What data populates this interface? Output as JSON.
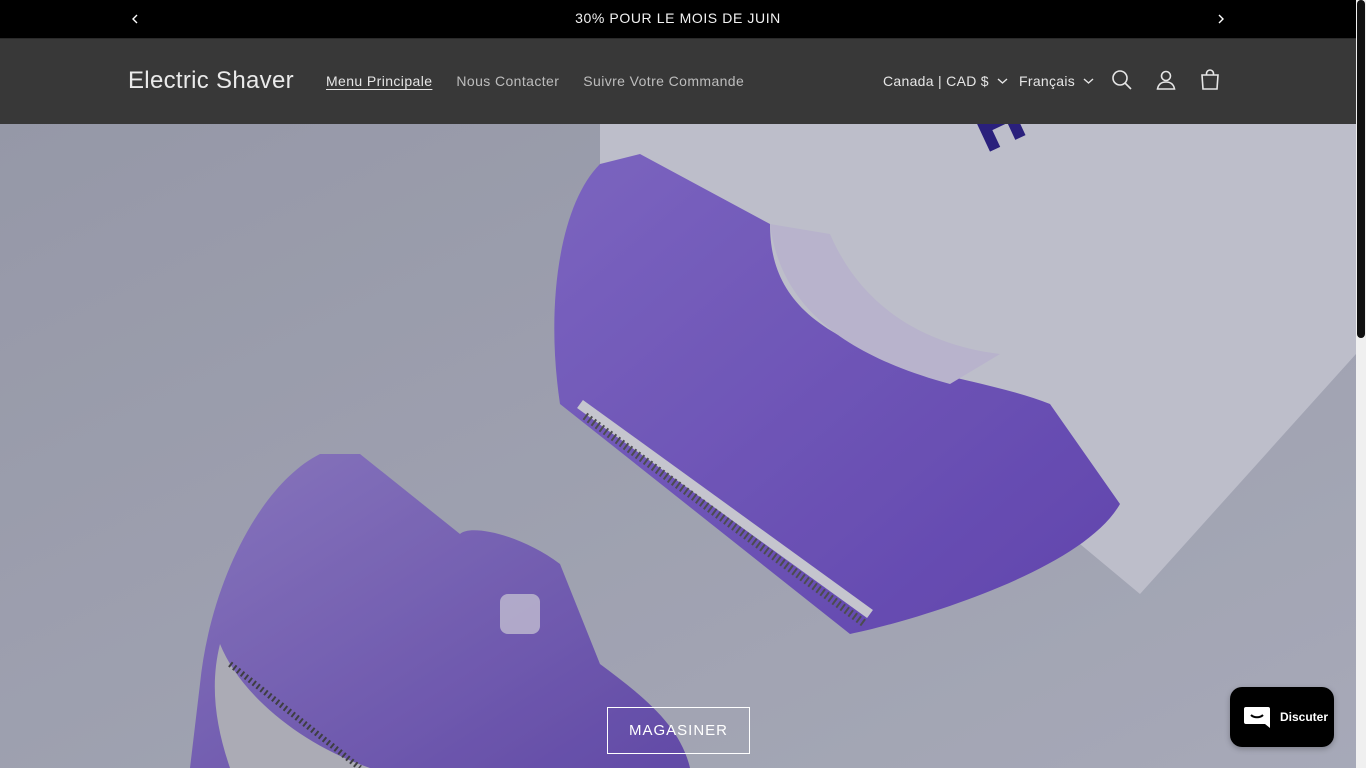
{
  "announcement": {
    "text": "30% POUR LE MOIS DE JUIN",
    "prev_icon": "chevron-left-icon",
    "next_icon": "chevron-right-icon"
  },
  "header": {
    "logo": "Electric Shaver",
    "nav": [
      {
        "label": "Menu Principale",
        "active": true
      },
      {
        "label": "Nous Contacter",
        "active": false
      },
      {
        "label": "Suivre Votre Commande",
        "active": false
      }
    ],
    "country": "Canada | CAD $",
    "language": "Français",
    "icons": [
      "search-icon",
      "account-icon",
      "cart-icon"
    ]
  },
  "hero": {
    "cta_label": "MAGASINER"
  },
  "chat": {
    "label": "Discuter",
    "icon": "chat-bubble-icon"
  },
  "colors": {
    "announcement_bg": "#000000",
    "header_bg": "#383838",
    "product_purple": "#7a5cd0",
    "chat_bg": "#000000"
  }
}
